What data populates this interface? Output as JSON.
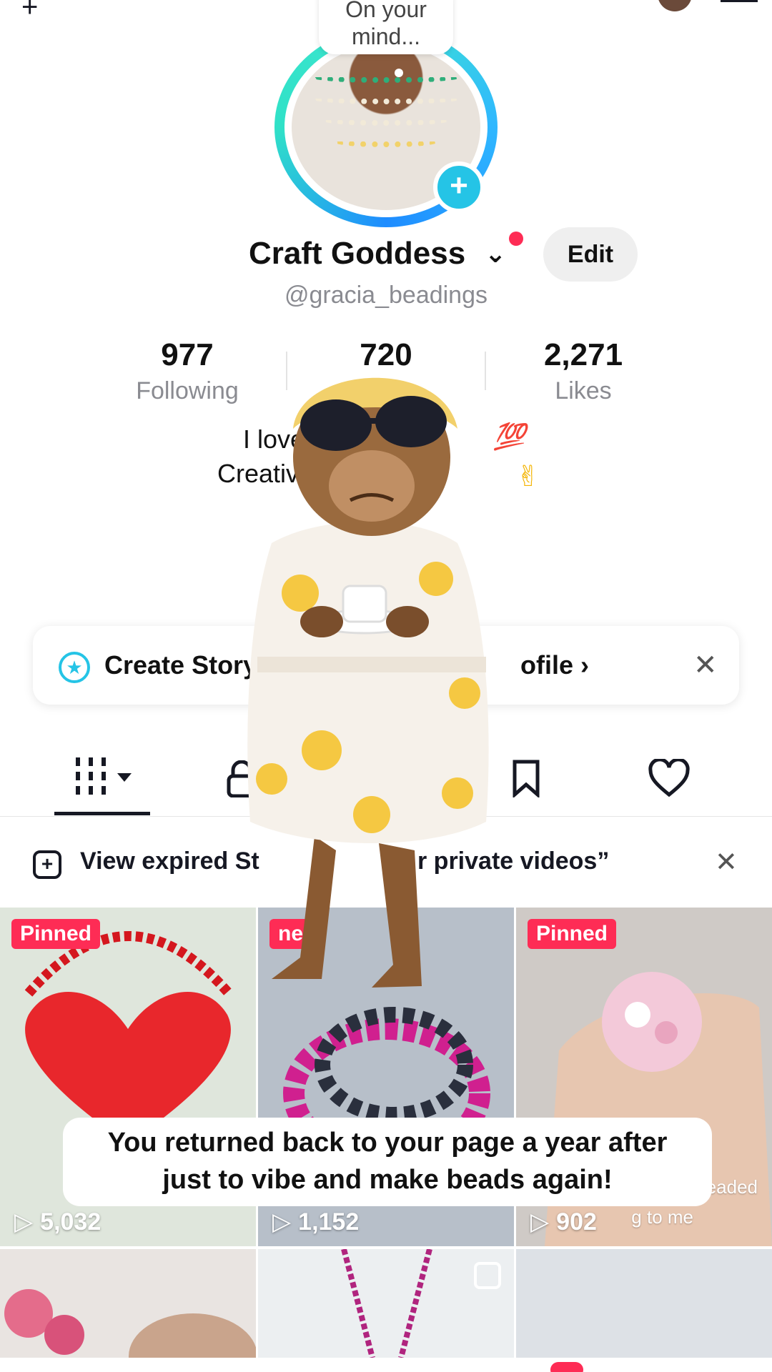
{
  "avatar": {
    "thought_bubble": "On your\nmind...",
    "add_story_symbol": "+"
  },
  "profile": {
    "display_name": "Craft Goddess",
    "handle": "@gracia_beadings",
    "edit_label": "Edit",
    "stats": [
      {
        "value": "977",
        "label": "Following"
      },
      {
        "value": "720",
        "label": "F"
      },
      {
        "value": "2,271",
        "label": "Likes"
      }
    ],
    "bio_line1": "I love",
    "bio_line2": "Creativ",
    "bio_emoji1": "💯",
    "bio_emoji2": "✌"
  },
  "story_banner": {
    "label_left": "Create Story",
    "label_right": "ofile",
    "chevron": "›",
    "close": "✕"
  },
  "tabs": [
    {
      "name": "videos",
      "icon": "grid-icon",
      "active": true
    },
    {
      "name": "private",
      "icon": "lock-icon",
      "active": false
    },
    {
      "name": "reposts",
      "icon": "repost-icon",
      "active": false
    },
    {
      "name": "saved",
      "icon": "bookmark-icon",
      "active": false
    },
    {
      "name": "liked",
      "icon": "heart-icon",
      "active": false
    }
  ],
  "expired_notice": {
    "text_left": "View expired St",
    "text_right": "r private videos”",
    "close": "✕"
  },
  "grid": [
    {
      "pinned": "Pinned",
      "views": "5,032",
      "color": "#e8272c",
      "bg": "#dfe6dc"
    },
    {
      "pinned": "ned",
      "views": "1,152",
      "color": "#d0208f",
      "bg": "#b7bfc9"
    },
    {
      "pinned": "Pinned",
      "views": "902",
      "color": "#f3c9d9",
      "bg": "#cfcac6",
      "caption1": "beaded",
      "caption2": "g to me"
    }
  ],
  "caption_overlay": {
    "line1": "You returned back to your page a year after",
    "line2": "just to vibe and make beads again!"
  },
  "colors": {
    "accent": "#fe2c55",
    "story_cyan": "#25c4e6"
  }
}
